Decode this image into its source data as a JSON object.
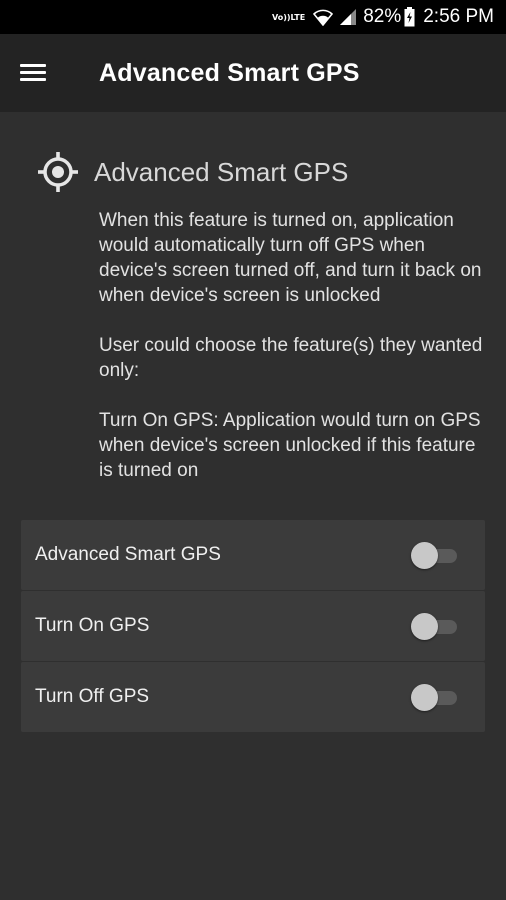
{
  "status_bar": {
    "volte_top": "Vo))",
    "volte_bottom": "LTE",
    "battery": "82%",
    "time": "2:56 PM"
  },
  "app_bar": {
    "title": "Advanced Smart GPS"
  },
  "feature": {
    "title": "Advanced Smart GPS",
    "paragraphs": [
      "When this feature is turned on, application would automatically turn off GPS when device's screen turned off, and turn it back on when device's screen is unlocked",
      "User could choose the feature(s) they wanted only:",
      "Turn On GPS: Application would turn on GPS when device's screen unlocked if this feature is turned on"
    ]
  },
  "settings": [
    {
      "label": "Advanced Smart GPS",
      "enabled": false
    },
    {
      "label": "Turn On GPS",
      "enabled": false
    },
    {
      "label": "Turn Off GPS",
      "enabled": false
    }
  ],
  "colors": {
    "app_bar": "#232323",
    "background": "#2f2f2f",
    "card": "#3b3b3b",
    "status_bar": "#000000"
  },
  "icons": [
    "menu-icon",
    "gps-fixed-icon",
    "wifi-icon",
    "signal-icon",
    "battery-icon"
  ]
}
